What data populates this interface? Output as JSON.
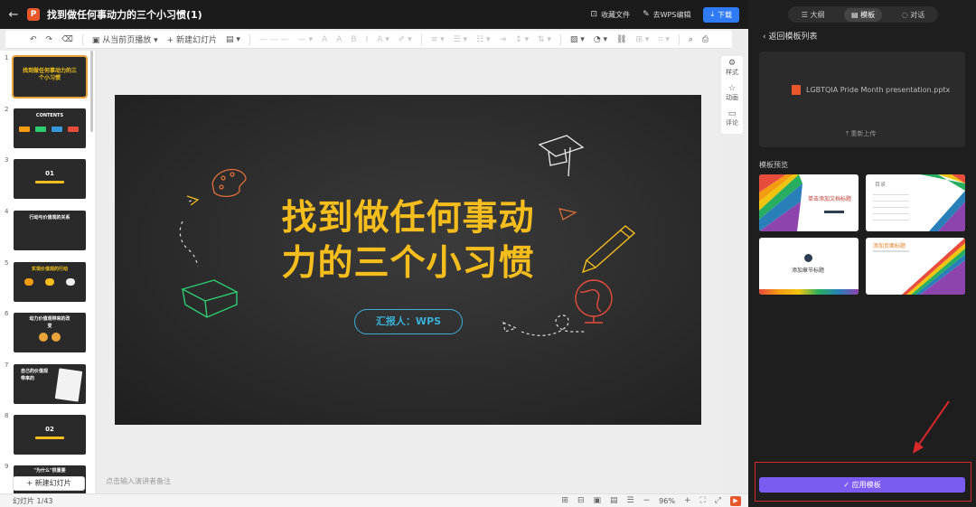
{
  "header": {
    "title": "找到做任何事动力的三个小习惯(1)",
    "app_logo": "P",
    "collect": "收藏文件",
    "to_wps": "去WPS编辑",
    "download": "下载"
  },
  "toolbar": {
    "play_from_current": "从当前页播放",
    "new_slide": "新建幻灯片"
  },
  "thumbnails": [
    {
      "num": "1",
      "text": "找到做任何事动力的三个小习惯",
      "style": "title"
    },
    {
      "num": "2",
      "text": "CONTENTS",
      "style": "contents"
    },
    {
      "num": "3",
      "text": "01",
      "style": "section"
    },
    {
      "num": "4",
      "text": "行动与价值观的关系",
      "style": "content"
    },
    {
      "num": "5",
      "text": "实现价值观的行动",
      "style": "content"
    },
    {
      "num": "6",
      "text": "动力价值观带来的改变",
      "style": "content"
    },
    {
      "num": "7",
      "text": "自己的价值观带来的",
      "style": "content"
    },
    {
      "num": "8",
      "text": "02",
      "style": "section"
    },
    {
      "num": "9",
      "text": "\"为什么\"很重要",
      "style": "content"
    }
  ],
  "new_slide_button": "新建幻灯片",
  "slide": {
    "title_line1": "找到做任何事动",
    "title_line2": "力的三个小习惯",
    "reporter": "汇报人：WPS"
  },
  "notes_placeholder": "点击输入演讲者备注",
  "side_tools": {
    "style": "样式",
    "animation": "动画",
    "comment": "评论"
  },
  "status": {
    "slide_count": "幻灯片 1/43",
    "zoom": "96%"
  },
  "right_panel": {
    "tabs": [
      "大纲",
      "模板",
      "对话"
    ],
    "active_tab": "模板",
    "back_to_list": "返回模板列表",
    "file_name": "LGBTQIA Pride Month presentation.pptx",
    "reupload": "重新上传",
    "preview_label": "模板预览",
    "templates": [
      {
        "title": "单击添加文档标题"
      },
      {
        "title": "目录"
      },
      {
        "title": "添加章节标题"
      },
      {
        "title": "添加页面标题"
      }
    ],
    "apply_button": "应用模板"
  },
  "colors": {
    "accent_purple": "#7b5cf0",
    "slide_yellow": "#f6be1c",
    "reporter_blue": "#3ab0d8",
    "highlight_red": "#d8282c",
    "download_blue": "#2f7bf5"
  }
}
